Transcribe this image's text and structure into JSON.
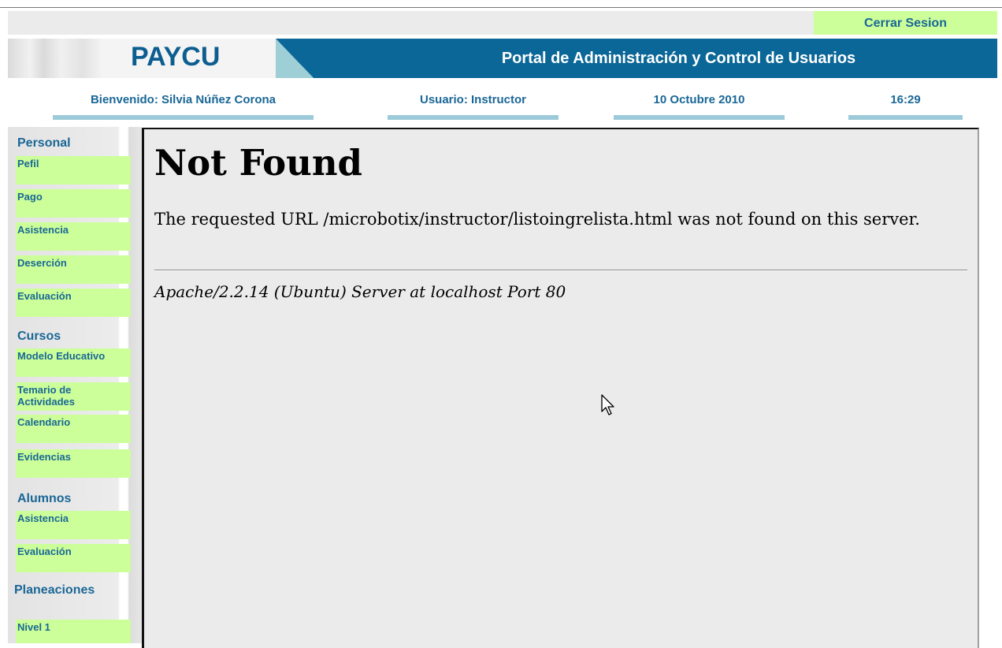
{
  "header": {
    "logout_label": "Cerrar Sesion",
    "logo": "PAYCU",
    "portal_title": "Portal de Administración y Control de Usuarios",
    "welcome": "Bienvenido: Silvia Núñez Corona",
    "user_role": "Usuario: Instructor",
    "date": "10 Octubre 2010",
    "time": "16:29"
  },
  "sidebar": {
    "personal": {
      "heading": "Personal",
      "items": [
        "Pefil",
        "Pago",
        "Asistencia",
        "Deserción",
        "Evaluación"
      ]
    },
    "cursos": {
      "heading": "Cursos",
      "items": [
        "Modelo Educativo",
        "Temario de Actividades",
        "Calendario",
        "Evidencias"
      ]
    },
    "alumnos": {
      "heading": "Alumnos",
      "items": [
        "Asistencia",
        "Evaluación"
      ]
    },
    "planeaciones": {
      "heading": "Planeaciones",
      "items": [
        "Nivel 1"
      ]
    }
  },
  "error_page": {
    "title": "Not Found",
    "message": "The requested URL /microbotix/instructor/listoingrelista.html was not found on this server.",
    "server_signature": "Apache/2.2.14 (Ubuntu) Server at localhost Port 80"
  },
  "colors": {
    "accent_blue": "#0b6797",
    "link_blue": "#1a6796",
    "menu_green": "#ccff99",
    "underline_blue": "#9ccad9"
  },
  "icons": {
    "pointer": "mouse-pointer-icon"
  }
}
